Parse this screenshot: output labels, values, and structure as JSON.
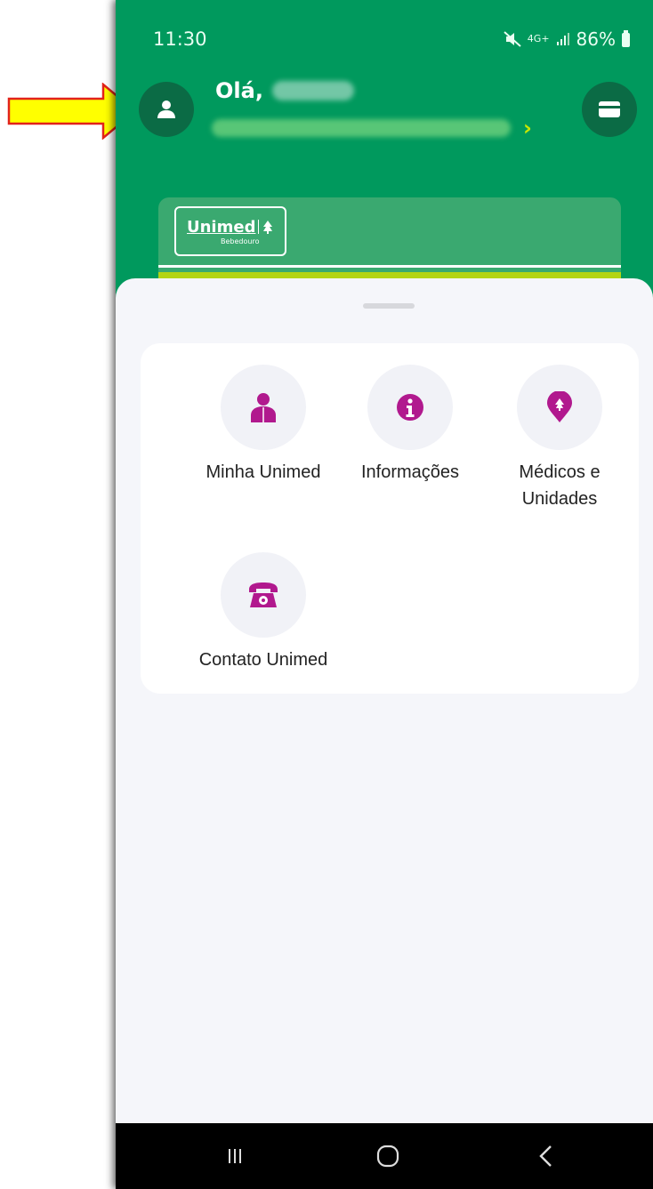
{
  "status_bar": {
    "time": "11:30",
    "network": "4G+",
    "battery": "86%"
  },
  "header": {
    "greeting": "Olá,"
  },
  "card": {
    "brand": "Unimed",
    "sub_brand": "Bebedouro"
  },
  "menu": {
    "items": [
      {
        "label": "Minha Unimed",
        "icon": "person-icon"
      },
      {
        "label": "Informações",
        "icon": "info-icon"
      },
      {
        "label": "Médicos e\nUnidades",
        "icon": "location-pin-icon"
      },
      {
        "label": "Contato Unimed",
        "icon": "telephone-icon"
      }
    ]
  },
  "colors": {
    "brand_green": "#00995d",
    "dark_green": "#0b6b45",
    "accent_lime": "#b3d414",
    "icon_magenta": "#b1198e",
    "annotation_arrow": "#ffff00"
  }
}
